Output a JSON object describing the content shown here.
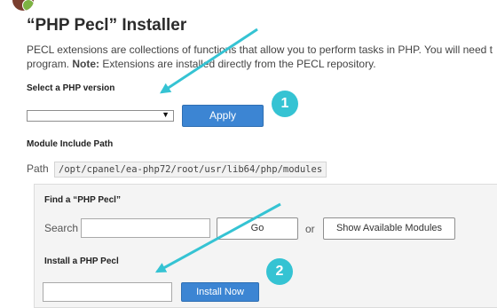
{
  "page": {
    "title": "“PHP Pecl” Installer",
    "description_line1": "PECL extensions are collections of functions that allow you to perform tasks in PHP. You will need t",
    "description_line2_start": "program.",
    "description_note_label": "Note:",
    "description_line2_end": "Extensions are installed directly from the PECL repository."
  },
  "version_section": {
    "label": "Select a PHP version",
    "selected_value": "",
    "apply_label": "Apply",
    "step_number": "1"
  },
  "module_path": {
    "label": "Module Include Path",
    "path_prefix": "Path",
    "path_value": "/opt/cpanel/ea-php72/root/usr/lib64/php/modules"
  },
  "find_section": {
    "label": "Find a “PHP Pecl”",
    "search_label": "Search",
    "search_value": "",
    "go_label": "Go",
    "or_text": "or",
    "show_modules_label": "Show Available Modules"
  },
  "install_section": {
    "label": "Install a PHP Pecl",
    "input_value": "",
    "install_label": "Install Now",
    "step_number": "2"
  },
  "colors": {
    "annotation_arrow": "#35c3d3",
    "primary_button": "#3c85d3",
    "step_badge": "#35c3d3"
  },
  "icons": {
    "app_logo": "php-pecl-logo-icon",
    "select_caret": "caret-down-icon"
  }
}
